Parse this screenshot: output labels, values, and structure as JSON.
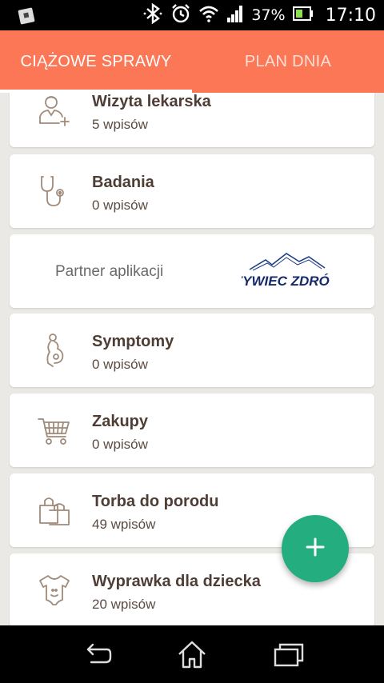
{
  "status_bar": {
    "battery_percent": "37%",
    "time": "17:10",
    "icons": [
      "app-notification-icon",
      "bluetooth-icon",
      "alarm-icon",
      "wifi-icon",
      "signal-icon",
      "battery-icon"
    ]
  },
  "tabs": [
    {
      "label": "CIĄŻOWE SPRAWY",
      "active": true
    },
    {
      "label": "PLAN DNIA",
      "active": false
    }
  ],
  "cards": [
    {
      "title": "Wizyta lekarska",
      "count": "5 wpisów",
      "icon": "doctor-icon"
    },
    {
      "title": "Badania",
      "count": "0 wpisów",
      "icon": "stethoscope-icon"
    },
    {
      "title": "Symptomy",
      "count": "0 wpisów",
      "icon": "pregnancy-icon"
    },
    {
      "title": "Zakupy",
      "count": "0 wpisów",
      "icon": "shopping-cart-icon"
    },
    {
      "title": "Torba do porodu",
      "count": "49 wpisów",
      "icon": "bag-icon"
    },
    {
      "title": "Wyprawka dla dziecka",
      "count": "20 wpisów",
      "icon": "baby-onesie-icon"
    }
  ],
  "partner": {
    "label": "Partner aplikacji",
    "logo_text": "ŻYWIEC ZDRÓJ"
  },
  "colors": {
    "header": "#fc7755",
    "fab": "#24ad7e",
    "text_dark": "#4e3d34",
    "icon": "#a08a7a",
    "background": "#ebe9e6"
  },
  "fab": {
    "icon": "plus-icon"
  },
  "nav_bar": {
    "icons": [
      "back-icon",
      "home-icon",
      "recent-apps-icon"
    ]
  }
}
